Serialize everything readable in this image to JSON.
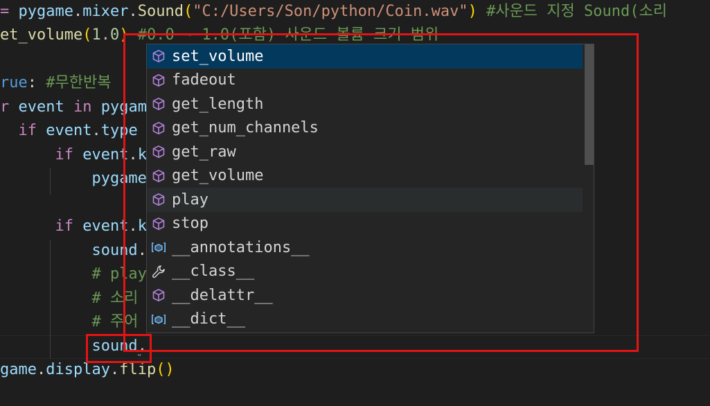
{
  "editor": {
    "lines": [
      {
        "segments": [
          {
            "c": "kw",
            "t": "= "
          },
          {
            "c": "var",
            "t": "pygame"
          },
          {
            "c": "plain",
            "t": "."
          },
          {
            "c": "var",
            "t": "mixer"
          },
          {
            "c": "plain",
            "t": "."
          },
          {
            "c": "func",
            "t": "Sound"
          },
          {
            "c": "brk",
            "t": "("
          },
          {
            "c": "str",
            "t": "\"C:/Users/Son/python/Coin.wav\""
          },
          {
            "c": "brk",
            "t": ")"
          },
          {
            "c": "plain",
            "t": " "
          },
          {
            "c": "cmt",
            "t": "#사운드 지정 Sound(소리"
          }
        ]
      },
      {
        "segments": [
          {
            "c": "func",
            "t": "et_volume"
          },
          {
            "c": "brk",
            "t": "("
          },
          {
            "c": "num",
            "t": "1.0"
          },
          {
            "c": "brk",
            "t": ")"
          },
          {
            "c": "plain",
            "t": " "
          },
          {
            "c": "cmt",
            "t": "#0.0 ~ 1.0(포함) 사운드 볼륨 크기 범위"
          }
        ]
      },
      {
        "segments": []
      },
      {
        "segments": [
          {
            "c": "const",
            "t": "rue"
          },
          {
            "c": "plain",
            "t": ": "
          },
          {
            "c": "cmt",
            "t": "#무한반복"
          }
        ]
      },
      {
        "segments": [
          {
            "c": "kw",
            "t": "r "
          },
          {
            "c": "var",
            "t": "event"
          },
          {
            "c": "plain",
            "t": " "
          },
          {
            "c": "kw",
            "t": "in"
          },
          {
            "c": "plain",
            "t": " "
          },
          {
            "c": "var",
            "t": "pygam"
          }
        ]
      },
      {
        "segments": [
          {
            "c": "plain",
            "t": "  "
          },
          {
            "c": "kw",
            "t": "if"
          },
          {
            "c": "plain",
            "t": " "
          },
          {
            "c": "var",
            "t": "event"
          },
          {
            "c": "plain",
            "t": "."
          },
          {
            "c": "var",
            "t": "type"
          }
        ]
      },
      {
        "segments": [
          {
            "c": "plain",
            "t": "      "
          },
          {
            "c": "kw",
            "t": "if"
          },
          {
            "c": "plain",
            "t": " "
          },
          {
            "c": "var",
            "t": "event"
          },
          {
            "c": "plain",
            "t": "."
          },
          {
            "c": "var",
            "t": "k"
          }
        ]
      },
      {
        "segments": [
          {
            "c": "plain",
            "t": "          "
          },
          {
            "c": "var",
            "t": "pygame"
          }
        ]
      },
      {
        "segments": []
      },
      {
        "segments": [
          {
            "c": "plain",
            "t": "      "
          },
          {
            "c": "kw",
            "t": "if"
          },
          {
            "c": "plain",
            "t": " "
          },
          {
            "c": "var",
            "t": "event"
          },
          {
            "c": "plain",
            "t": "."
          },
          {
            "c": "var",
            "t": "k"
          }
        ]
      },
      {
        "segments": [
          {
            "c": "plain",
            "t": "          "
          },
          {
            "c": "var",
            "t": "sound"
          },
          {
            "c": "plain",
            "t": "."
          }
        ]
      },
      {
        "segments": [
          {
            "c": "plain",
            "t": "          "
          },
          {
            "c": "cmt",
            "t": "# play"
          }
        ]
      },
      {
        "segments": [
          {
            "c": "plain",
            "t": "          "
          },
          {
            "c": "cmt",
            "t": "# 소리"
          }
        ]
      },
      {
        "segments": [
          {
            "c": "plain",
            "t": "          "
          },
          {
            "c": "cmt",
            "t": "# 주어"
          }
        ]
      },
      {
        "segments": [
          {
            "c": "plain",
            "t": "          "
          },
          {
            "c": "var",
            "t": "sound"
          },
          {
            "c": "plain",
            "t": "."
          }
        ]
      },
      {
        "segments": [
          {
            "c": "var",
            "t": "game"
          },
          {
            "c": "plain",
            "t": "."
          },
          {
            "c": "var",
            "t": "display"
          },
          {
            "c": "plain",
            "t": "."
          },
          {
            "c": "func",
            "t": "flip"
          },
          {
            "c": "brk",
            "t": "()"
          }
        ]
      }
    ],
    "squiggle": "ᵕ"
  },
  "suggestions": {
    "items": [
      {
        "label": "set_volume",
        "icon": "method-icon",
        "state": "selected"
      },
      {
        "label": "fadeout",
        "icon": "method-icon",
        "state": ""
      },
      {
        "label": "get_length",
        "icon": "method-icon",
        "state": ""
      },
      {
        "label": "get_num_channels",
        "icon": "method-icon",
        "state": ""
      },
      {
        "label": "get_raw",
        "icon": "method-icon",
        "state": ""
      },
      {
        "label": "get_volume",
        "icon": "method-icon",
        "state": ""
      },
      {
        "label": "play",
        "icon": "method-icon",
        "state": "hovered"
      },
      {
        "label": "stop",
        "icon": "method-icon",
        "state": ""
      },
      {
        "label": "__annotations__",
        "icon": "field-icon",
        "state": ""
      },
      {
        "label": "__class__",
        "icon": "wrench-icon",
        "state": ""
      },
      {
        "label": "__delattr__",
        "icon": "method-icon",
        "state": ""
      },
      {
        "label": "__dict__",
        "icon": "field-icon",
        "state": ""
      }
    ]
  },
  "colors": {
    "highlight_box": "#e51414",
    "selected_bg": "#04395e",
    "method_icon": "#b180d7",
    "field_icon": "#75beff"
  }
}
